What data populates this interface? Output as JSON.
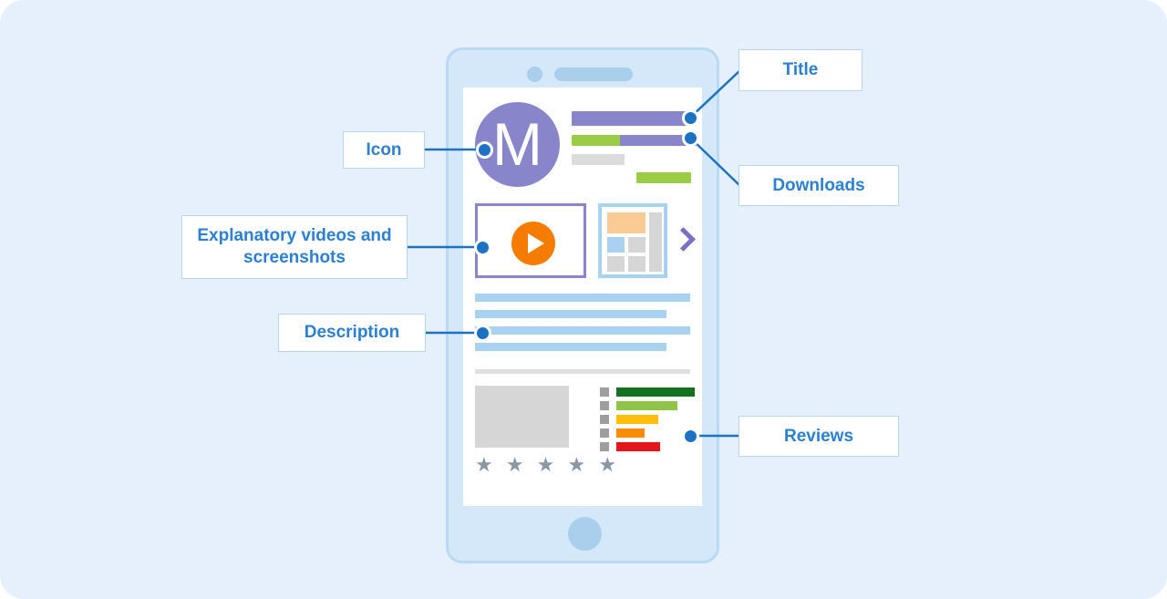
{
  "page": {
    "background_color": "#e5f0fc",
    "title": "Annotated mobile app store listing diagram"
  },
  "device": {
    "name": "smartphone-mockup",
    "frame_color": "#d4e8f9",
    "border_color": "#b8daf2",
    "camera_label": "camera",
    "speaker_label": "speaker",
    "home_button_label": "home-button"
  },
  "app_listing": {
    "icon": {
      "letter": "M",
      "background_color": "#8985ca",
      "text_color": "#ffffff"
    },
    "header_bars": [
      {
        "name": "title-bar",
        "color": "#8985ca"
      },
      {
        "name": "rating-bar",
        "color": "#9acd45"
      },
      {
        "name": "downloads-bar",
        "color": "#8985ca"
      },
      {
        "name": "developer-bar",
        "color": "#dcdcdc"
      },
      {
        "name": "install-button-bar",
        "color": "#9acd45"
      }
    ],
    "media": {
      "video_label": "video-preview",
      "video_border_color": "#8985ca",
      "play_color": "#f57c00",
      "screenshot_label": "screenshot-thumbnail",
      "screenshot_border_color": "#a8d2f0",
      "screenshot_accent_color": "#fbcb96",
      "next_label": "next-media"
    },
    "description": {
      "line_color": "#a8d2f0",
      "lines": 4
    },
    "reviews": {
      "thumb_label": "review-image",
      "stars": "★ ★ ★ ★ ★",
      "star_count": 5,
      "star_color": "#8b97a5",
      "rating_bars": [
        {
          "name": "5-star",
          "color": "#15711f",
          "width_pct": 100
        },
        {
          "name": "4-star",
          "color": "#90c347",
          "width_pct": 78
        },
        {
          "name": "3-star",
          "color": "#fdbe0c",
          "width_pct": 54
        },
        {
          "name": "2-star",
          "color": "#fa8c05",
          "width_pct": 36
        },
        {
          "name": "1-star",
          "color": "#e4151b",
          "width_pct": 56
        }
      ]
    }
  },
  "callouts": {
    "title": "Title",
    "icon": "Icon",
    "downloads": "Downloads",
    "videos": "Explanatory videos and screenshots",
    "description": "Description",
    "reviews": "Reviews",
    "accent_color": "#2b7fd4",
    "border_color": "#b6d8f2",
    "dot_color": "#1d72c4"
  }
}
